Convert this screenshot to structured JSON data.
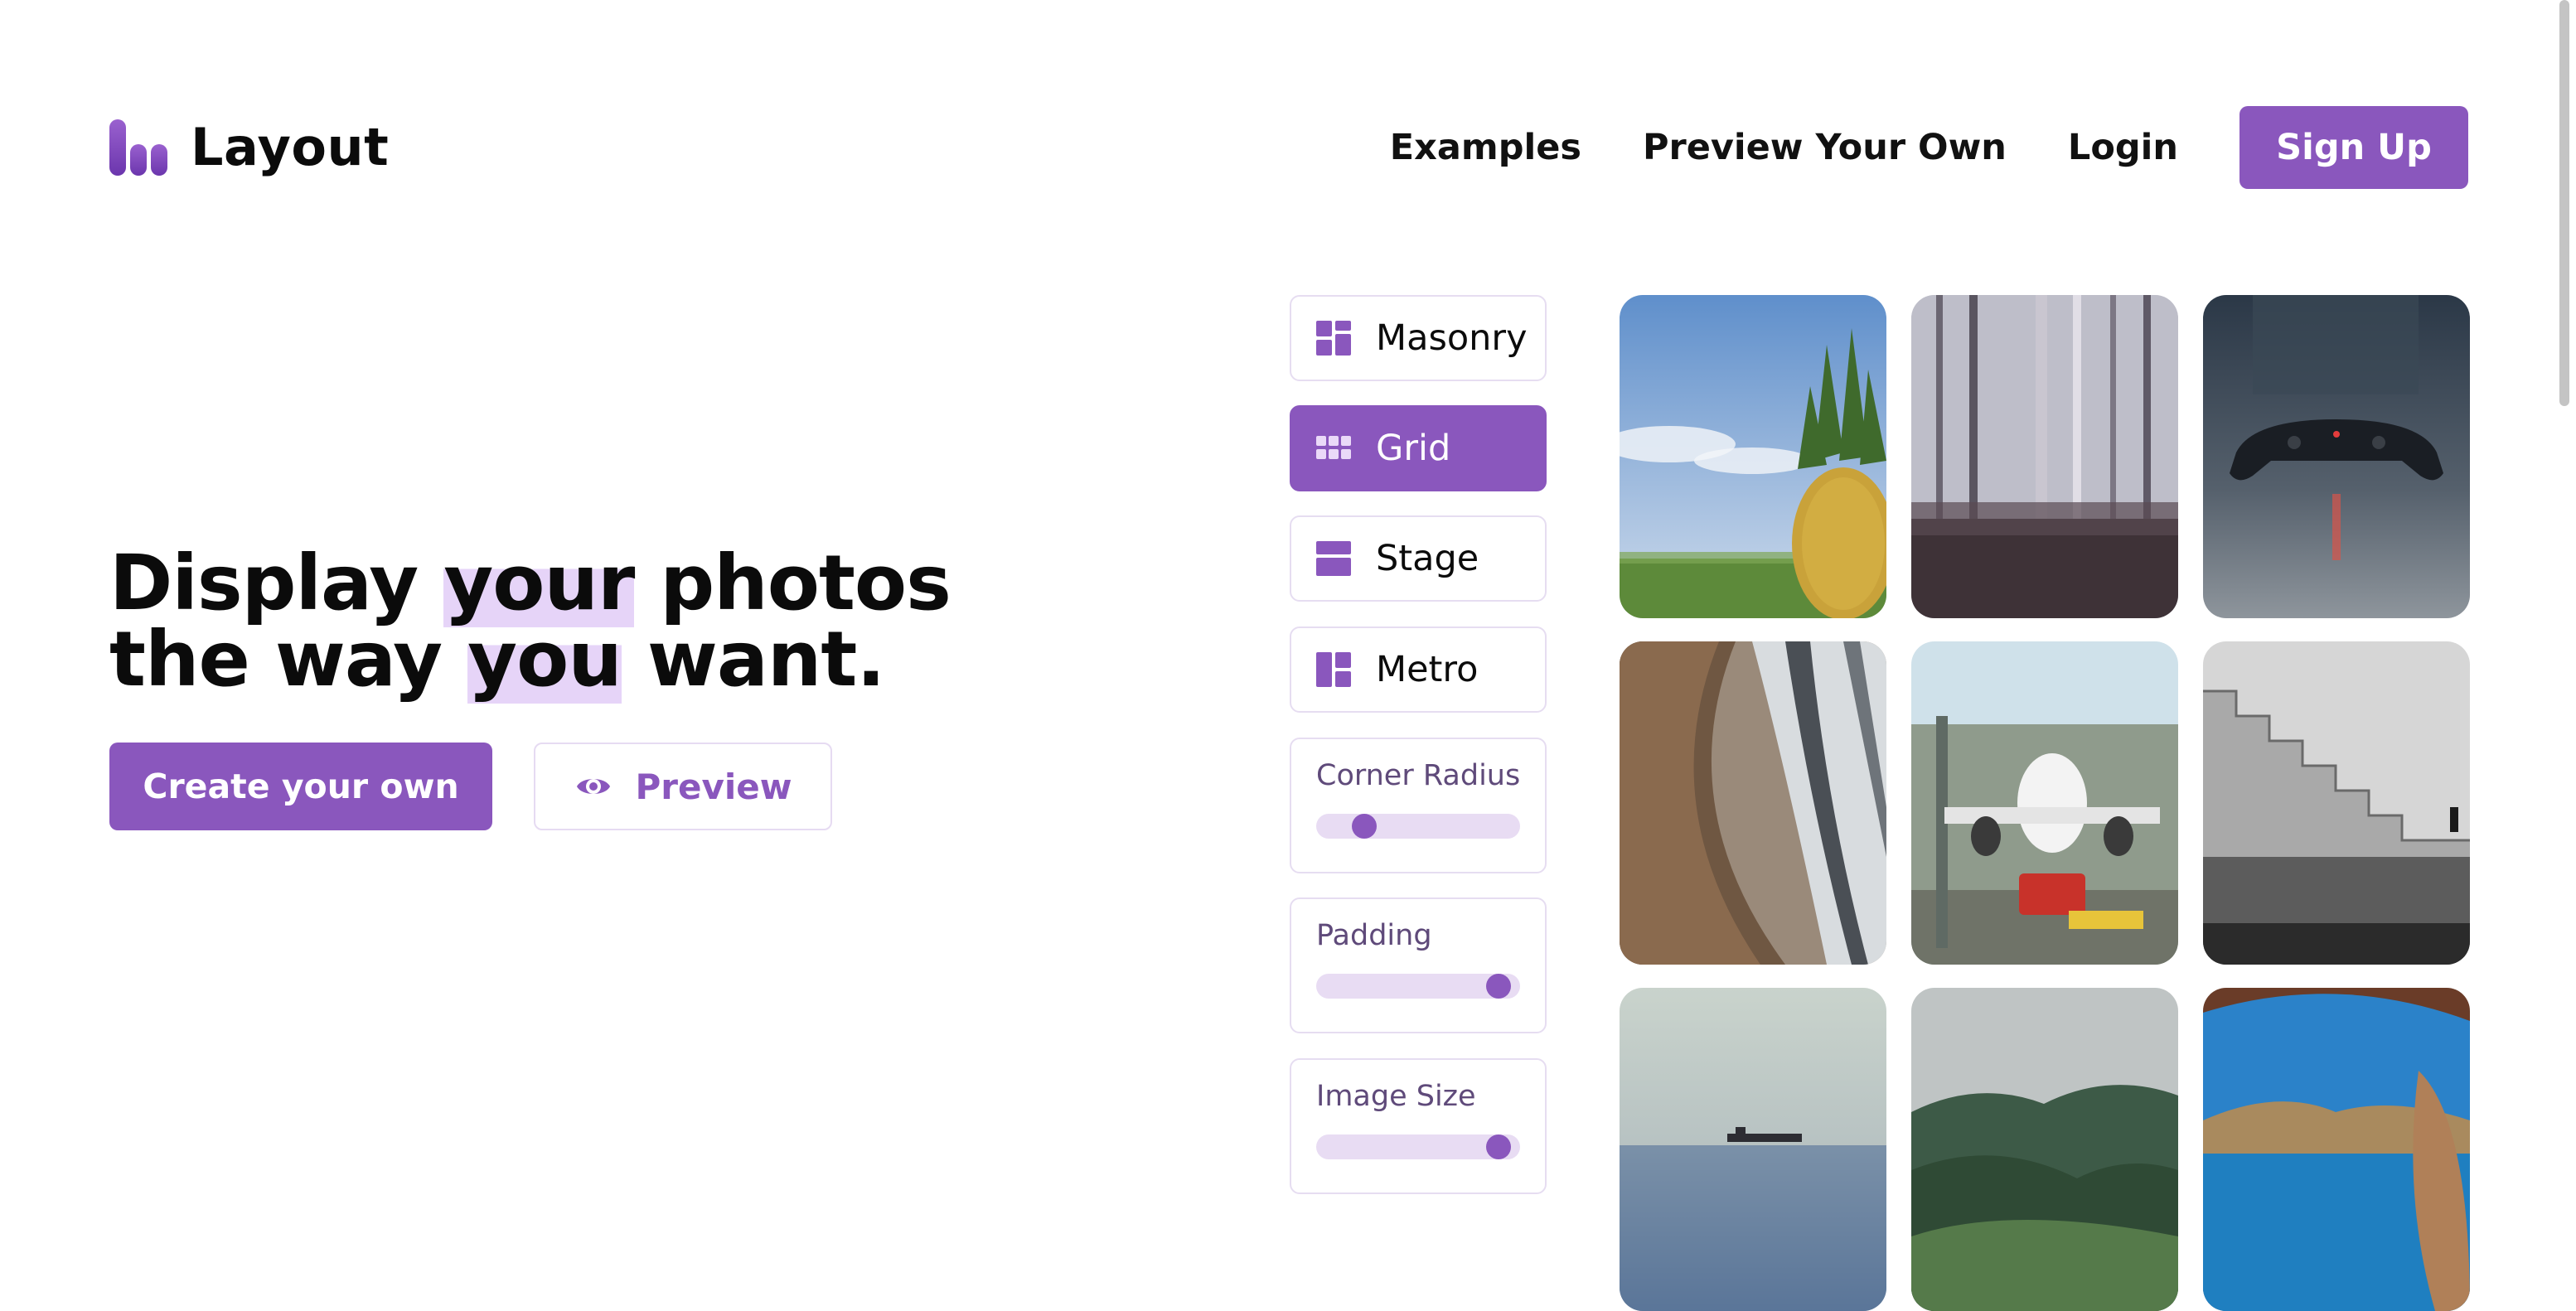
{
  "header": {
    "logo_text": "Layout",
    "nav": {
      "examples": "Examples",
      "preview_your_own": "Preview Your Own",
      "login": "Login",
      "sign_up": "Sign Up"
    }
  },
  "hero": {
    "line1_a": "Display ",
    "line1_hl": "your",
    "line1_b": " photos",
    "line2_a": "the way ",
    "line2_hl": "you",
    "line2_b": " want.",
    "create_button": "Create your own",
    "preview_button": "Preview"
  },
  "controls": {
    "layouts": [
      {
        "label": "Masonry",
        "icon": "masonry-icon",
        "active": false
      },
      {
        "label": "Grid",
        "icon": "grid-icon",
        "active": true
      },
      {
        "label": "Stage",
        "icon": "stage-icon",
        "active": false
      },
      {
        "label": "Metro",
        "icon": "metro-icon",
        "active": false
      }
    ],
    "sliders": [
      {
        "label": "Corner Radius",
        "value": 0.2
      },
      {
        "label": "Padding",
        "value": 0.95
      },
      {
        "label": "Image Size",
        "value": 0.95
      }
    ]
  },
  "photos": [
    {
      "subject": "pineapple"
    },
    {
      "subject": "misty-forest"
    },
    {
      "subject": "game-controller"
    },
    {
      "subject": "library-bookshelves"
    },
    {
      "subject": "airplane"
    },
    {
      "subject": "stone-staircase"
    },
    {
      "subject": "sea-ship"
    },
    {
      "subject": "foggy-hills"
    },
    {
      "subject": "sea-cave"
    }
  ],
  "colors": {
    "accent": "#8a57bd",
    "accent_light": "#e8dcf3",
    "highlight": "#e6d4f8"
  }
}
